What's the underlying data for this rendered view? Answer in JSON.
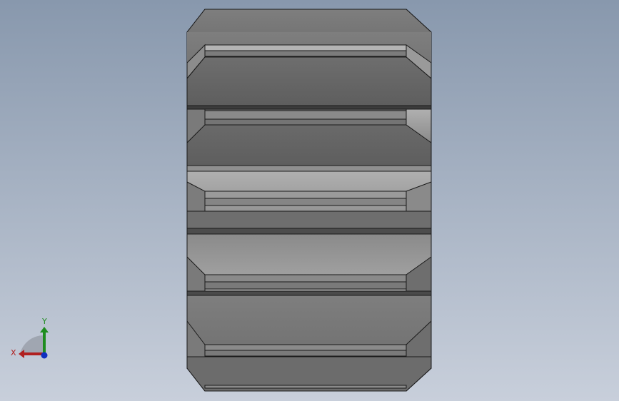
{
  "view": {
    "background_top": "#8a9aae",
    "background_bottom": "#c6cdd9",
    "part_face_dark": "#5a5a5a",
    "part_face_mid": "#7a7a7a",
    "part_face_light": "#a8a8a8",
    "edge_color": "#1a1a1a"
  },
  "part": {
    "name": "gear-side-view",
    "tooth_count_visible": 5
  },
  "triad": {
    "x_label": "X",
    "y_label": "Y",
    "x_color": "#b02020",
    "y_color": "#1e8c1e",
    "z_color": "#1030c0"
  }
}
